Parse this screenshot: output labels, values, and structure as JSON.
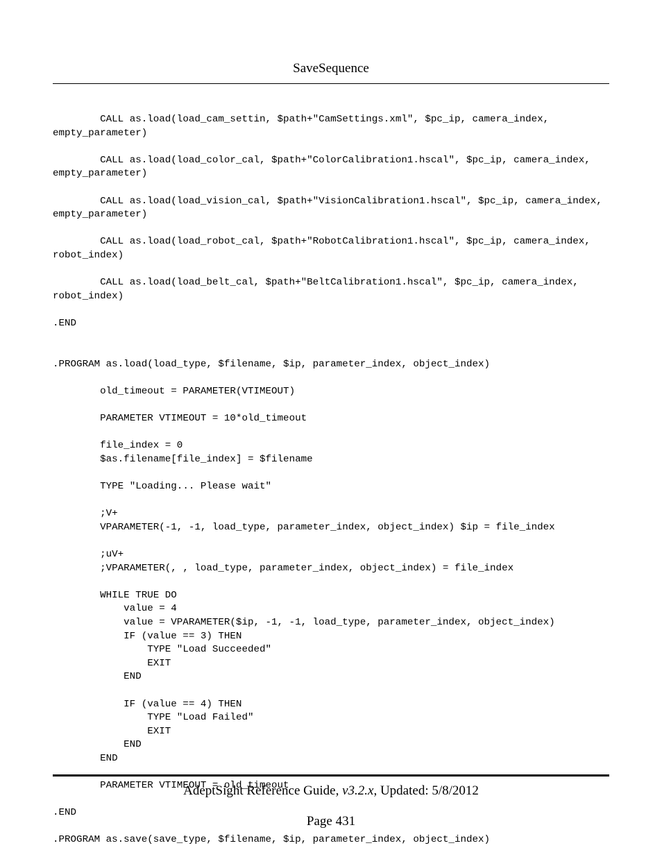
{
  "header": {
    "title": "SaveSequence"
  },
  "code": "        CALL as.load(load_cam_settin, $path+\"CamSettings.xml\", $pc_ip, camera_index, empty_parameter)\n\n        CALL as.load(load_color_cal, $path+\"ColorCalibration1.hscal\", $pc_ip, camera_index, empty_parameter)\n\n        CALL as.load(load_vision_cal, $path+\"VisionCalibration1.hscal\", $pc_ip, camera_index, empty_parameter)\n\n        CALL as.load(load_robot_cal, $path+\"RobotCalibration1.hscal\", $pc_ip, camera_index, robot_index)\n\n        CALL as.load(load_belt_cal, $path+\"BeltCalibration1.hscal\", $pc_ip, camera_index, robot_index)\n\n.END\n\n\n.PROGRAM as.load(load_type, $filename, $ip, parameter_index, object_index)\n\n        old_timeout = PARAMETER(VTIMEOUT)\n\n        PARAMETER VTIMEOUT = 10*old_timeout\n\n        file_index = 0\n        $as.filename[file_index] = $filename\n\n        TYPE \"Loading... Please wait\"\n\n        ;V+\n        VPARAMETER(-1, -1, load_type, parameter_index, object_index) $ip = file_index\n\n        ;uV+\n        ;VPARAMETER(, , load_type, parameter_index, object_index) = file_index\n\n        WHILE TRUE DO\n            value = 4\n            value = VPARAMETER($ip, -1, -1, load_type, parameter_index, object_index)\n            IF (value == 3) THEN\n                TYPE \"Load Succeeded\"\n                EXIT\n            END\n\n            IF (value == 4) THEN\n                TYPE \"Load Failed\"\n                EXIT\n            END\n        END\n\n        PARAMETER VTIMEOUT = old_timeout\n\n.END\n\n.PROGRAM as.save(save_type, $filename, $ip, parameter_index, object_index)",
  "footer": {
    "guide": "AdeptSight Reference Guide",
    "version": ", v3.2.x",
    "updated": ", Updated: 5/8/2012",
    "page_label": "Page 431"
  }
}
